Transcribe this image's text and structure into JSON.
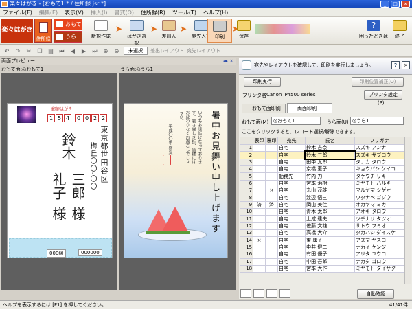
{
  "window": {
    "title": "楽々はがき - [おもて1 * / 住所録.jsr *]",
    "minimize": "_",
    "maximize": "□",
    "close": "×"
  },
  "menu": [
    "ファイル(F)",
    "編集(E)",
    "表示(V)",
    "挿入(I)",
    "書式(O)",
    "住所録(R)",
    "ツール(T)",
    "ヘルプ(H)"
  ],
  "toolbar": {
    "logo": "楽々はがき",
    "address_book": "住所録",
    "omote": "おもて",
    "ura": "うら",
    "buttons": [
      "新規作成",
      "はがき選択",
      "差出人",
      "宛先入力",
      "印刷",
      "保存",
      "困ったときは",
      "終了"
    ]
  },
  "subtoolbar": {
    "unselected": "未選択",
    "sender_layout": "差出レイアウト",
    "to_layout": "宛先レイアウト"
  },
  "preview": {
    "title": "両面プレビュー",
    "front_label": "おもて面:◎おもて1",
    "back_label": "うら面:◎うら1"
  },
  "front": {
    "header": "郵便はがき",
    "zip": [
      "1",
      "5",
      "4",
      "0",
      "0",
      "2",
      "2"
    ],
    "address": "東京都世田谷区",
    "address2": "梅丘〇〇-〇〇",
    "name_family": "鈴木",
    "name1": "三郎",
    "name2": "礼子",
    "honorific": "様",
    "stamp_text": "000組",
    "number": "000000"
  },
  "back": {
    "title": "暑中お見舞い申し上げます",
    "body": "いつもお世話になっております。暑さ厳しき折、皆様にはお変わりなくお過ごしでしょうか。",
    "date": "平成〇〇年 盛夏"
  },
  "right": {
    "hint": "宛先やレイアウトを確認して、印刷を実行しましょう。",
    "print_button": "印刷実行",
    "print_pos": "印刷位置補正(O)",
    "printer_label": "プリンタ名",
    "printer_name": "Canon iP4500 series",
    "printer_settings": "プリンタ設定(P)...",
    "tab_front": "おもて面印刷",
    "tab_both": "両面印刷",
    "front_face": "おもて面(M)",
    "front_face_value": "◎おもて1",
    "back_face": "うら面(U)",
    "back_face_value": "◎うら1",
    "select_hint": "ここをクリックすると、レコード選択/解除できます。",
    "auto_confirm": "自動確認",
    "record_count": "41/41件"
  },
  "table": {
    "columns": [
      "",
      "表印",
      "裏印",
      "宛先",
      "氏名",
      "フリガナ"
    ],
    "rows": [
      [
        "1",
        "",
        "",
        "自宅",
        "鈴木 吉奈",
        "スズキ アンナ"
      ],
      [
        "2",
        "",
        "",
        "自宅",
        "鈴木 三郎",
        "スズキ サブロウ"
      ],
      [
        "3",
        "",
        "",
        "自宅",
        "田中 太郎",
        "タナカ タロウ"
      ],
      [
        "4",
        "",
        "",
        "自宅",
        "京橋 恵子",
        "キョウバシ ケイコ"
      ],
      [
        "5",
        "",
        "",
        "勤務先",
        "竹内 力",
        "タケウチ リキ"
      ],
      [
        "6",
        "",
        "",
        "自宅",
        "宮本 治樹",
        "ミヤモト ハルキ"
      ],
      [
        "7",
        "",
        "×",
        "自宅",
        "丸山 茂雄",
        "マルヤマ シゲオ"
      ],
      [
        "8",
        "",
        "",
        "自宅",
        "渡辺 悟三",
        "ワタナベ ゴゾウ"
      ],
      [
        "9",
        "済",
        "済",
        "自宅",
        "岡山 美佳",
        "オカヤマ ミカ"
      ],
      [
        "10",
        "",
        "",
        "自宅",
        "青木 太郎",
        "アオキ タロウ"
      ],
      [
        "11",
        "",
        "",
        "自宅",
        "土成 達夫",
        "ツチナリ タツオ"
      ],
      [
        "12",
        "",
        "",
        "自宅",
        "佐藤 文雄",
        "サトウ フミオ"
      ],
      [
        "13",
        "",
        "",
        "自宅",
        "高橋 大介",
        "タカハシ ダイスケ"
      ],
      [
        "14",
        "×",
        "",
        "自宅",
        "東 康子",
        "アズマ ヤスコ"
      ],
      [
        "15",
        "",
        "",
        "自宅",
        "中井 健二",
        "ナカイ ケンジ"
      ],
      [
        "16",
        "",
        "",
        "自宅",
        "有田 優子",
        "アリタ ユウコ"
      ],
      [
        "17",
        "",
        "",
        "自宅",
        "中田 吾郎",
        "ナカタ ゴロウ"
      ],
      [
        "18",
        "",
        "",
        "自宅",
        "宮本 大作",
        "ミヤモト ダイサク"
      ]
    ]
  },
  "status": "ヘルプを表示するには [F1] を押してください。"
}
